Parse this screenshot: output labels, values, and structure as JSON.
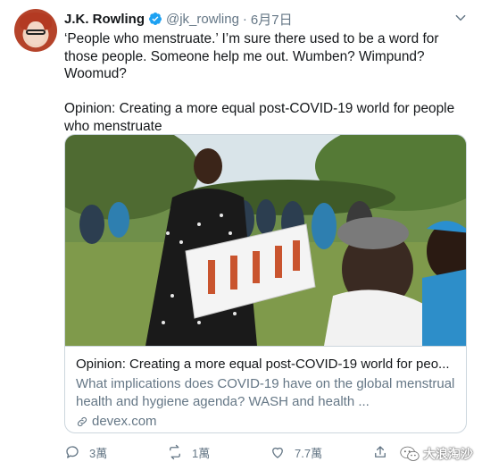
{
  "author": {
    "name": "J.K. Rowling",
    "handle": "@jk_rowling",
    "separator": "·",
    "date": "6月7日"
  },
  "tweet": {
    "paragraph_1": "‘People who menstruate.’ I’m sure there used to be a word for those people. Someone help me out. Wumben? Wimpund? Woomud?",
    "paragraph_2": "Opinion: Creating a more equal post-COVID-19 world for people who menstruate"
  },
  "card": {
    "title": "Opinion: Creating a more equal post-COVID-19 world for peo...",
    "description": "What implications does COVID-19 have on the global menstrual health and hygiene agenda? WASH and health ...",
    "domain": "devex.com",
    "image_icon": "photo-woman-presenting-chart-to-seated-group"
  },
  "actions": {
    "reply_count": "3萬",
    "retweet_count": "1萬",
    "like_count": "7.7萬"
  },
  "watermark": {
    "text": "大浪淘沙",
    "icon": "wechat-icon"
  },
  "colors": {
    "text": "#14171a",
    "secondary": "#657786",
    "verified": "#1da1f2",
    "border": "#ccd6dd"
  }
}
